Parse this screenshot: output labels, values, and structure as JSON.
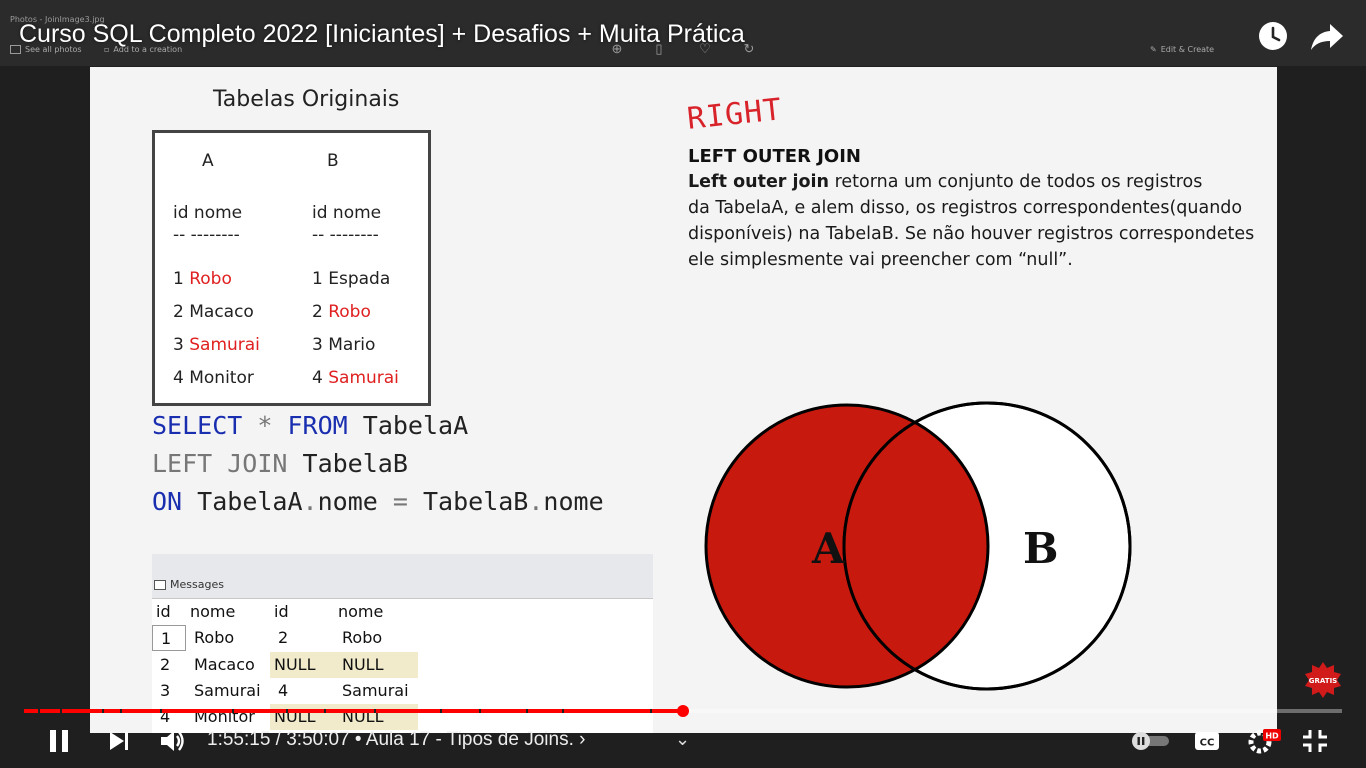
{
  "video": {
    "title": "Curso SQL Completo 2022 [Iniciantes] + Desafios + Muita Prática",
    "time": "1:55:15 / 3:50:07",
    "chapter": "• Aula 17 - Tipos de Joins.",
    "chapter_arrow": "›",
    "progress_fraction": 0.5,
    "badge_text": "GRATIS"
  },
  "photos_app": {
    "file_title": "Photos - JoinImage3.jpg",
    "see_all": "See all photos",
    "add_creation": "Add to a creation",
    "edit_create": "Edit & Create"
  },
  "slide": {
    "tables_title": "Tabelas Originais",
    "col_a": "A",
    "col_b": "B",
    "hdr_a": "id nome",
    "hdr_b": "id nome",
    "dash_a": "-- --------",
    "dash_b": "-- --------",
    "rows_a": [
      {
        "id": "1",
        "name": "Robo"
      },
      {
        "id": "2",
        "name": "Macaco"
      },
      {
        "id": "3",
        "name": "Samurai"
      },
      {
        "id": "4",
        "name": "Monitor"
      }
    ],
    "rows_b": [
      {
        "id": "1",
        "name": "Espada"
      },
      {
        "id": "2",
        "name": "Robo"
      },
      {
        "id": "3",
        "name": "Mario"
      },
      {
        "id": "4",
        "name": "Samurai"
      }
    ],
    "handwriting": "RIGHT",
    "desc_title": "LEFT OUTER JOIN",
    "desc_bold": "Left outer join",
    "desc_1": " retorna um conjunto  de todos os registros",
    "desc_2": "da TabelaA, e alem disso, os registros correspondentes(quando",
    "desc_3": "disponíveis) na TabelaB. Se não houver registros correspondetes",
    "desc_4": "ele simplesmente vai preencher com “null”.",
    "sql": {
      "select": "SELECT",
      "star": "*",
      "from": "FROM",
      "t1": "TabelaA",
      "left_join": "LEFT JOIN",
      "t2": "TabelaB",
      "on": "ON",
      "cond_a": "TabelaA",
      "dot": ".",
      "nome": "nome",
      "eq": "=",
      "cond_b": "TabelaB"
    },
    "result": {
      "messages_tab": "Messages",
      "headers": [
        "id",
        "nome",
        "id",
        "nome"
      ],
      "rows": [
        [
          "1",
          "Robo",
          "2",
          "Robo"
        ],
        [
          "2",
          "Macaco",
          "NULL",
          "NULL"
        ],
        [
          "3",
          "Samurai",
          "4",
          "Samurai"
        ],
        [
          "4",
          "Monitor",
          "NULL",
          "NULL"
        ]
      ]
    },
    "venn": {
      "label_a": "A",
      "label_b": "B",
      "fill": "#c8190f"
    }
  }
}
